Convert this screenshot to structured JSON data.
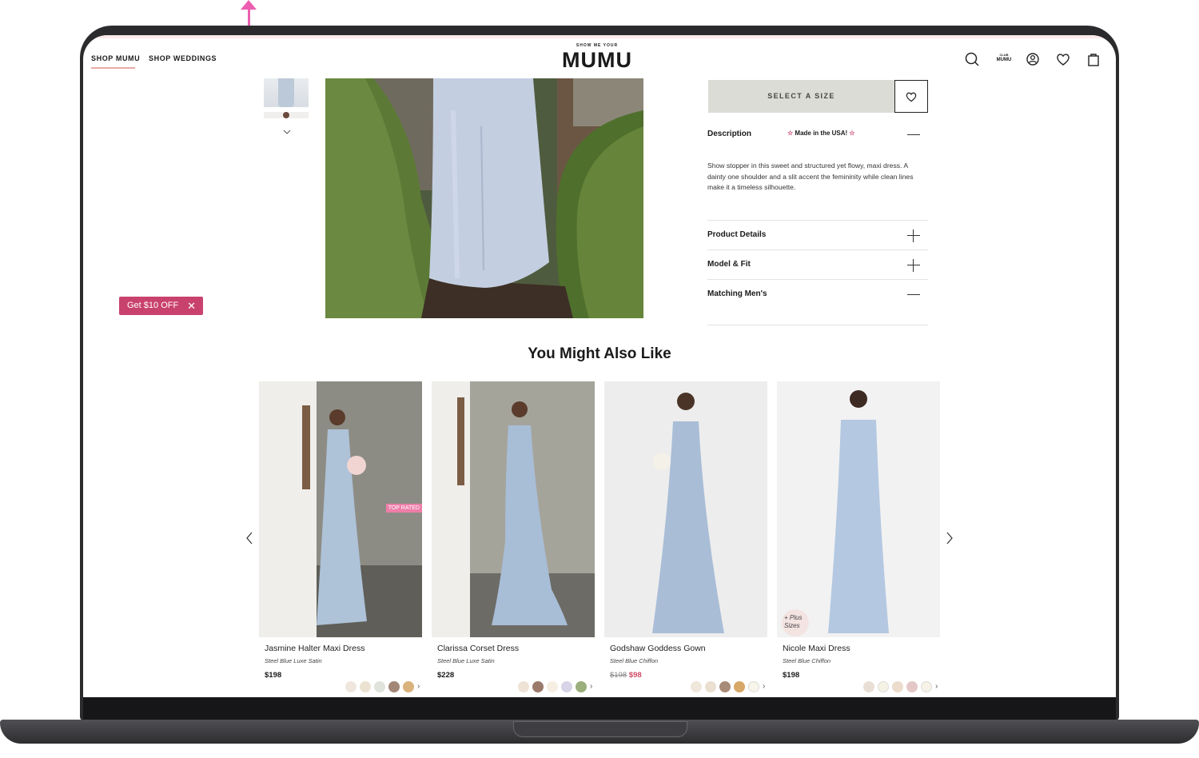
{
  "header": {
    "nav": [
      "SHOP MUMU",
      "SHOP WEDDINGS"
    ],
    "logo_small": "SHOW ME YOUR",
    "logo": "MUMU",
    "club": [
      "CLUB",
      "MUMU"
    ],
    "icons": [
      "search-icon",
      "club-mumu-icon",
      "account-icon",
      "wishlist-icon",
      "bag-icon"
    ]
  },
  "promo": {
    "label": "Get $10 OFF",
    "close": "✕"
  },
  "product": {
    "select_size": "SELECT A SIZE",
    "description_label": "Description",
    "made_in": "Made in the USA!",
    "description": "Show stopper in this sweet and structured yet flowy, maxi dress. A dainty one shoulder and a slit accent the femininity while clean lines make it a timeless silhouette.",
    "accordions": [
      "Product Details",
      "Model & Fit",
      "Matching Men's"
    ]
  },
  "recommendations": {
    "title": "You Might Also Like",
    "items": [
      {
        "name": "Jasmine Halter Maxi Dress",
        "color": "Steel Blue Luxe Satin",
        "price": "$198",
        "badge": "TOP RATED",
        "swatches": [
          "#efe6dd",
          "#ece2d2",
          "#dfe3dc",
          "#a28676",
          "#d9b27c"
        ]
      },
      {
        "name": "Clarissa Corset Dress",
        "color": "Steel Blue Luxe Satin",
        "price": "$228",
        "swatches": [
          "#efe3d6",
          "#9b7a6b",
          "#f6eee2",
          "#d8d3e6",
          "#9aaf7c"
        ]
      },
      {
        "name": "Godshaw Goddess Gown",
        "color": "Steel Blue Chiffon",
        "price_old": "$198",
        "price_sale": "$98",
        "swatches": [
          "#efe6dc",
          "#eadfd0",
          "#a88a79",
          "#d7a867",
          "#f7f5ea"
        ]
      },
      {
        "name": "Nicole Maxi Dress",
        "color": "Steel Blue Chiffon",
        "price": "$198",
        "plus_badge": [
          "+ Plus",
          "Sizes"
        ],
        "swatches": [
          "#eadfd5",
          "#f6f2e4",
          "#ecdccb",
          "#e3c8c7",
          "#f6f3e6"
        ]
      }
    ]
  },
  "colors": {
    "accent_pink": "#c9426e",
    "badge_pink": "#ee7ea8",
    "sale_red": "#d04a68",
    "annotation": "#ec5fb0"
  }
}
